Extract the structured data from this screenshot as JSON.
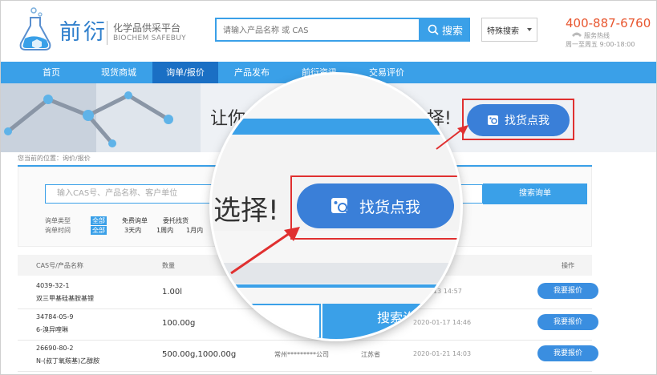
{
  "brand": {
    "name": "前衍",
    "subtitle_cn": "化学品供采平台",
    "subtitle_en": "BIOCHEM SAFEBUY"
  },
  "search": {
    "placeholder": "请输入产品名称 或 CAS",
    "button": "搜索",
    "mode": "特殊搜索"
  },
  "contact": {
    "phone": "400-887-6760",
    "hotline_label": "服务热线",
    "hours": "周一至周五  9:00-18:00"
  },
  "nav": [
    "首页",
    "现货商城",
    "询单/报价",
    "产品发布",
    "前衍资讯",
    "交易评价"
  ],
  "nav_active": 2,
  "banner": {
    "text_left": "让你的",
    "text_right": "选择!",
    "find_button": "找货点我"
  },
  "breadcrumb": "您当前的位置：询价/报价",
  "query": {
    "placeholder": "输入CAS号、产品名称、客户单位",
    "button": "搜索询单"
  },
  "filters": {
    "type_label": "询单类型",
    "time_label": "询单时间",
    "type_all": "全部",
    "time_all": "全部",
    "col2_top": "免费询单",
    "col2_bottom": "3天内",
    "col3_top": "委托找货",
    "col3_bottom": "1周内",
    "col4_bottom": "1月内"
  },
  "table": {
    "headers": {
      "cas_name": "CAS号/产品名称",
      "qty": "数量",
      "action": "操作"
    },
    "rows": [
      {
        "cas": "4039-32-1",
        "name": "双三甲基硅基胺基锂",
        "qty": "1.00l",
        "company": "",
        "region": "",
        "date": "13 14:57",
        "action": "我要报价"
      },
      {
        "cas": "34784-05-9",
        "name": "6-溴异喹啉",
        "qty": "100.00g",
        "company": "",
        "region": "",
        "date": "2020-01-17 14:46",
        "action": "我要报价"
      },
      {
        "cas": "26690-80-2",
        "name": "N-(叔丁氧羰基)乙醇胺",
        "qty": "500.00g,1000.00g",
        "company": "常州*********公司",
        "region": "江苏省",
        "date": "2020-01-21 14:03",
        "action": "我要报价"
      }
    ]
  },
  "magnifier": {
    "text": "选择!",
    "button": "找货点我",
    "search_text": "搜索询"
  },
  "colors": {
    "primary": "#3aa0e8",
    "nav_active": "#1a6fc4",
    "button": "#3a7fd8",
    "highlight": "#e03030",
    "phone": "#e8562f"
  }
}
